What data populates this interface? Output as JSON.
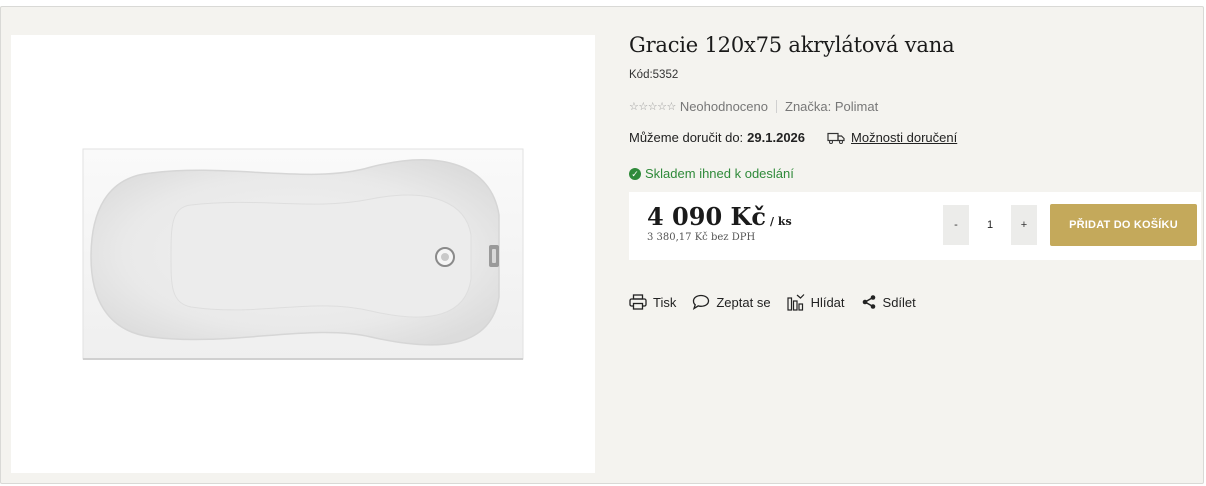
{
  "product": {
    "title": "Gracie 120x75 akrylátová vana",
    "code_label": "Kód:5352",
    "rating_stars": "☆☆☆☆☆",
    "rating_text": "Neohodnoceno",
    "brand_label": "Značka: Polimat",
    "delivery_prefix": "Můžeme doručit do:",
    "delivery_date": "29.1.2026",
    "delivery_link": "Možnosti doručení",
    "stock_text": "Skladem ihned k odeslání",
    "stock_color": "#2f8a3a"
  },
  "pricing": {
    "price": "4 090 Kč",
    "unit": "/ ks",
    "net_price": "3 380,17 Kč bez DPH"
  },
  "cart": {
    "minus_label": "-",
    "quantity": "1",
    "plus_label": "+",
    "add_label": "PŘIDAT DO KOŠÍKU",
    "accent_color": "#c4a95b"
  },
  "actions": [
    {
      "label": "Tisk",
      "icon": "printer-icon"
    },
    {
      "label": "Zeptat se",
      "icon": "chat-bubble-icon"
    },
    {
      "label": "Hlídat",
      "icon": "watch-chart-icon"
    },
    {
      "label": "Sdílet",
      "icon": "share-icon"
    }
  ]
}
